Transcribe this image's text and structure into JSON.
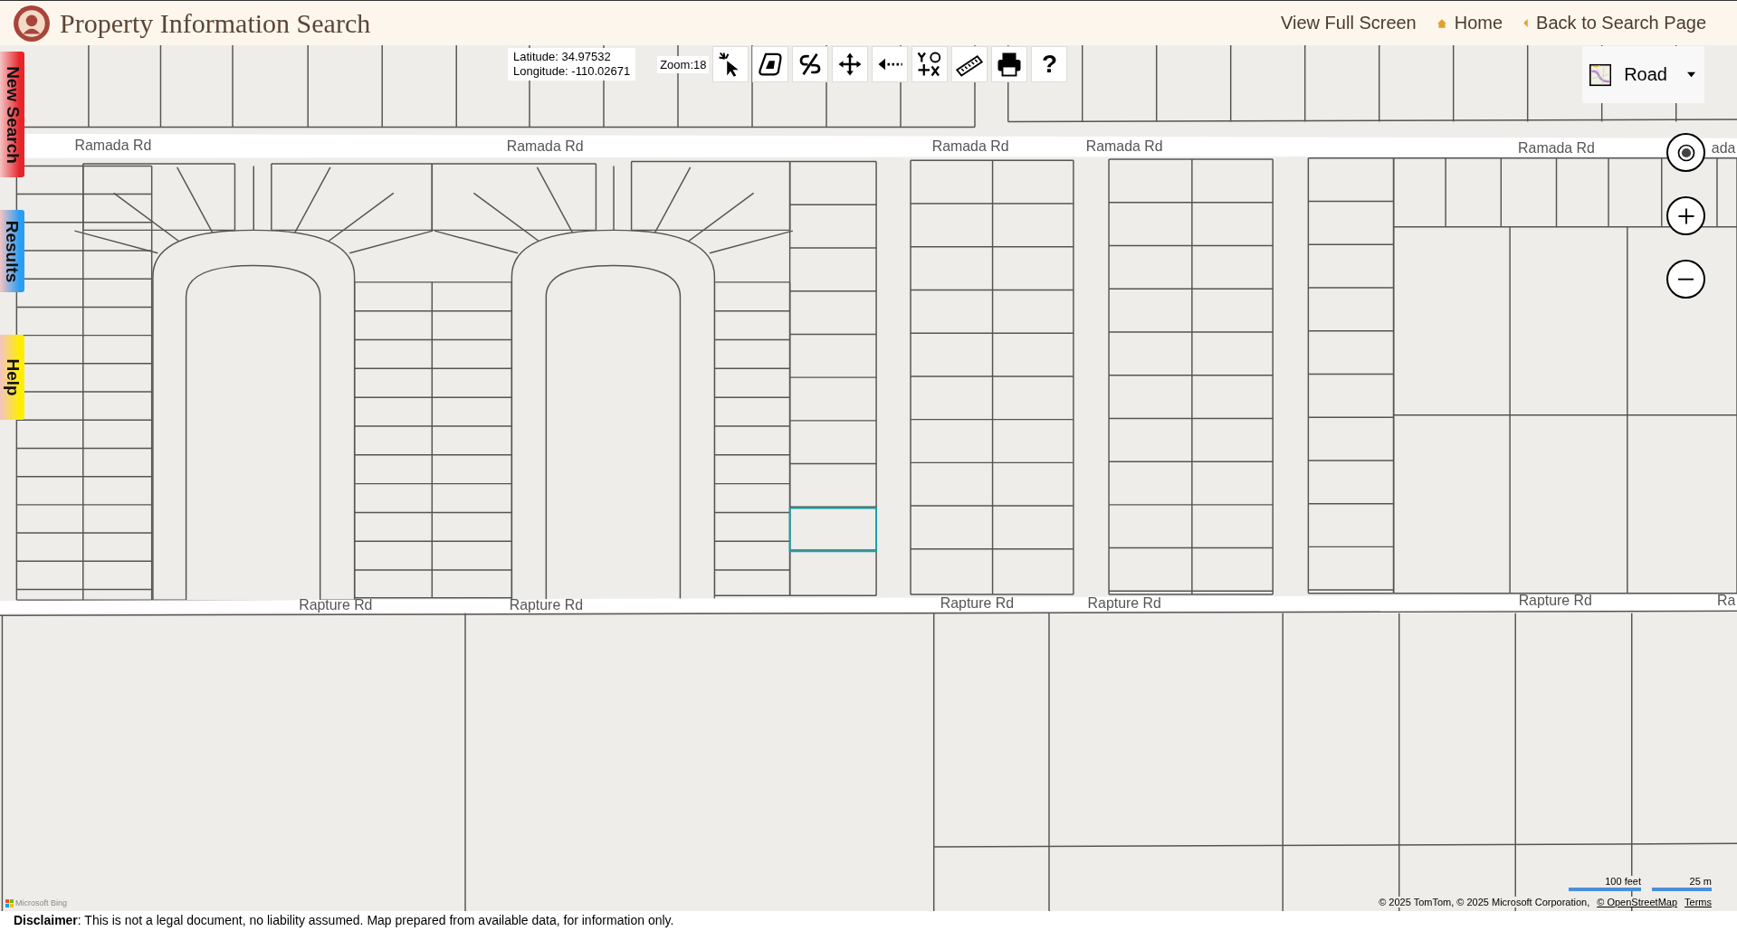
{
  "header": {
    "title": "Property Information Search",
    "links": [
      {
        "kind": "plain",
        "label": "View Full Screen"
      },
      {
        "kind": "home",
        "label": "Home"
      },
      {
        "kind": "back",
        "label": "Back to Search Page"
      }
    ]
  },
  "side_tabs": [
    {
      "label": "New Search",
      "color": "#e8252b"
    },
    {
      "label": "Results",
      "color": "#2a9df4"
    },
    {
      "label": "Help",
      "color": "#ffee00"
    }
  ],
  "coordinates": {
    "latitude": "Latitude: 34.97532",
    "longitude": "Longitude: -110.02671"
  },
  "zoom": "Zoom:18",
  "tools": [
    {
      "kind": "identify"
    },
    {
      "kind": "polygon"
    },
    {
      "kind": "split"
    },
    {
      "kind": "pan"
    },
    {
      "kind": "back"
    },
    {
      "kind": "xy"
    },
    {
      "kind": "measure"
    },
    {
      "kind": "print"
    },
    {
      "kind": "help",
      "label": "?"
    }
  ],
  "map": {
    "style": "Road",
    "road_labels": [
      {
        "name": "Ramada Rd"
      },
      {
        "name": "Ramada Rd"
      },
      {
        "name": "Ramada Rd"
      },
      {
        "name": "Ramada Rd"
      },
      {
        "name": "Ramada Rd"
      },
      {
        "name": "ada"
      },
      {
        "name": "Rapture Rd"
      },
      {
        "name": "Rapture Rd"
      },
      {
        "name": "Rapture Rd"
      },
      {
        "name": "Rapture Rd"
      },
      {
        "name": "Rapture Rd"
      },
      {
        "name": "Ra"
      }
    ],
    "provider": "Microsoft Bing",
    "scale": [
      "100 feet",
      "25 m"
    ],
    "attribution": "© 2025 TomTom, © 2025 Microsoft Corporation,",
    "links": [
      "© OpenStreetMap",
      "Terms"
    ]
  },
  "disclaimer": "**Disclaimer**: This is not a legal document, no liability assumed. Map prepared from available data, for information only."
}
